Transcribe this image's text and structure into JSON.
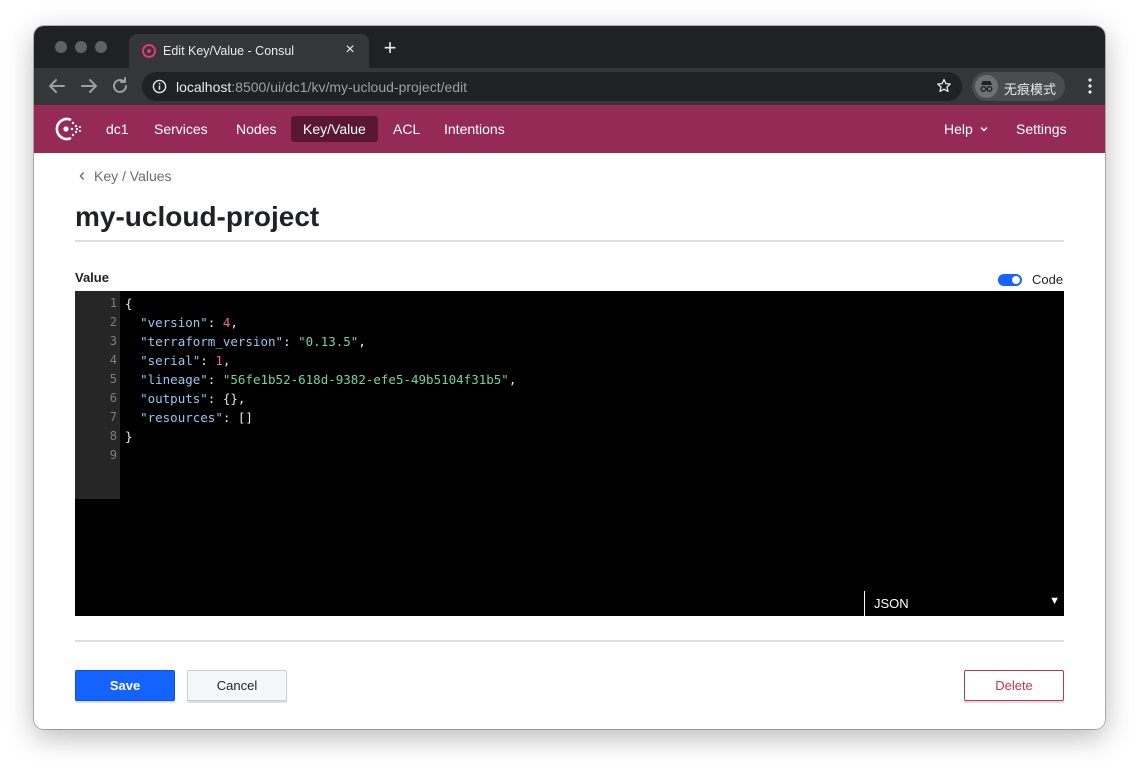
{
  "browser": {
    "tab_title": "Edit Key/Value - Consul",
    "tab_close": "×",
    "new_tab": "+",
    "url_host": "localhost",
    "url_rest": ":8500/ui/dc1/kv/my-ucloud-project/edit",
    "incognito_label": "无痕模式"
  },
  "nav": {
    "dc": "dc1",
    "items": [
      "Services",
      "Nodes",
      "Key/Value",
      "ACL",
      "Intentions"
    ],
    "active": "Key/Value",
    "help": "Help",
    "settings": "Settings",
    "accent_color": "#962a57",
    "active_color": "#5a1734"
  },
  "page": {
    "breadcrumb": "Key / Values",
    "title": "my-ucloud-project",
    "value_label": "Value",
    "code_toggle_label": "Code",
    "code_toggle_on": true
  },
  "editor": {
    "lines": [
      "{",
      "  \"version\": 4,",
      "  \"terraform_version\": \"0.13.5\",",
      "  \"serial\": 1,",
      "  \"lineage\": \"56fe1b52-618d-9382-efe5-49b5104f31b5\",",
      "  \"outputs\": {},",
      "  \"resources\": []",
      "}",
      ""
    ],
    "line_numbers": [
      "1",
      "2",
      "3",
      "4",
      "5",
      "6",
      "7",
      "8",
      "9"
    ],
    "language": "JSON",
    "language_arrow": "▼"
  },
  "actions": {
    "save": "Save",
    "cancel": "Cancel",
    "delete": "Delete",
    "primary_color": "#1563ff",
    "danger_color": "#c73445"
  }
}
